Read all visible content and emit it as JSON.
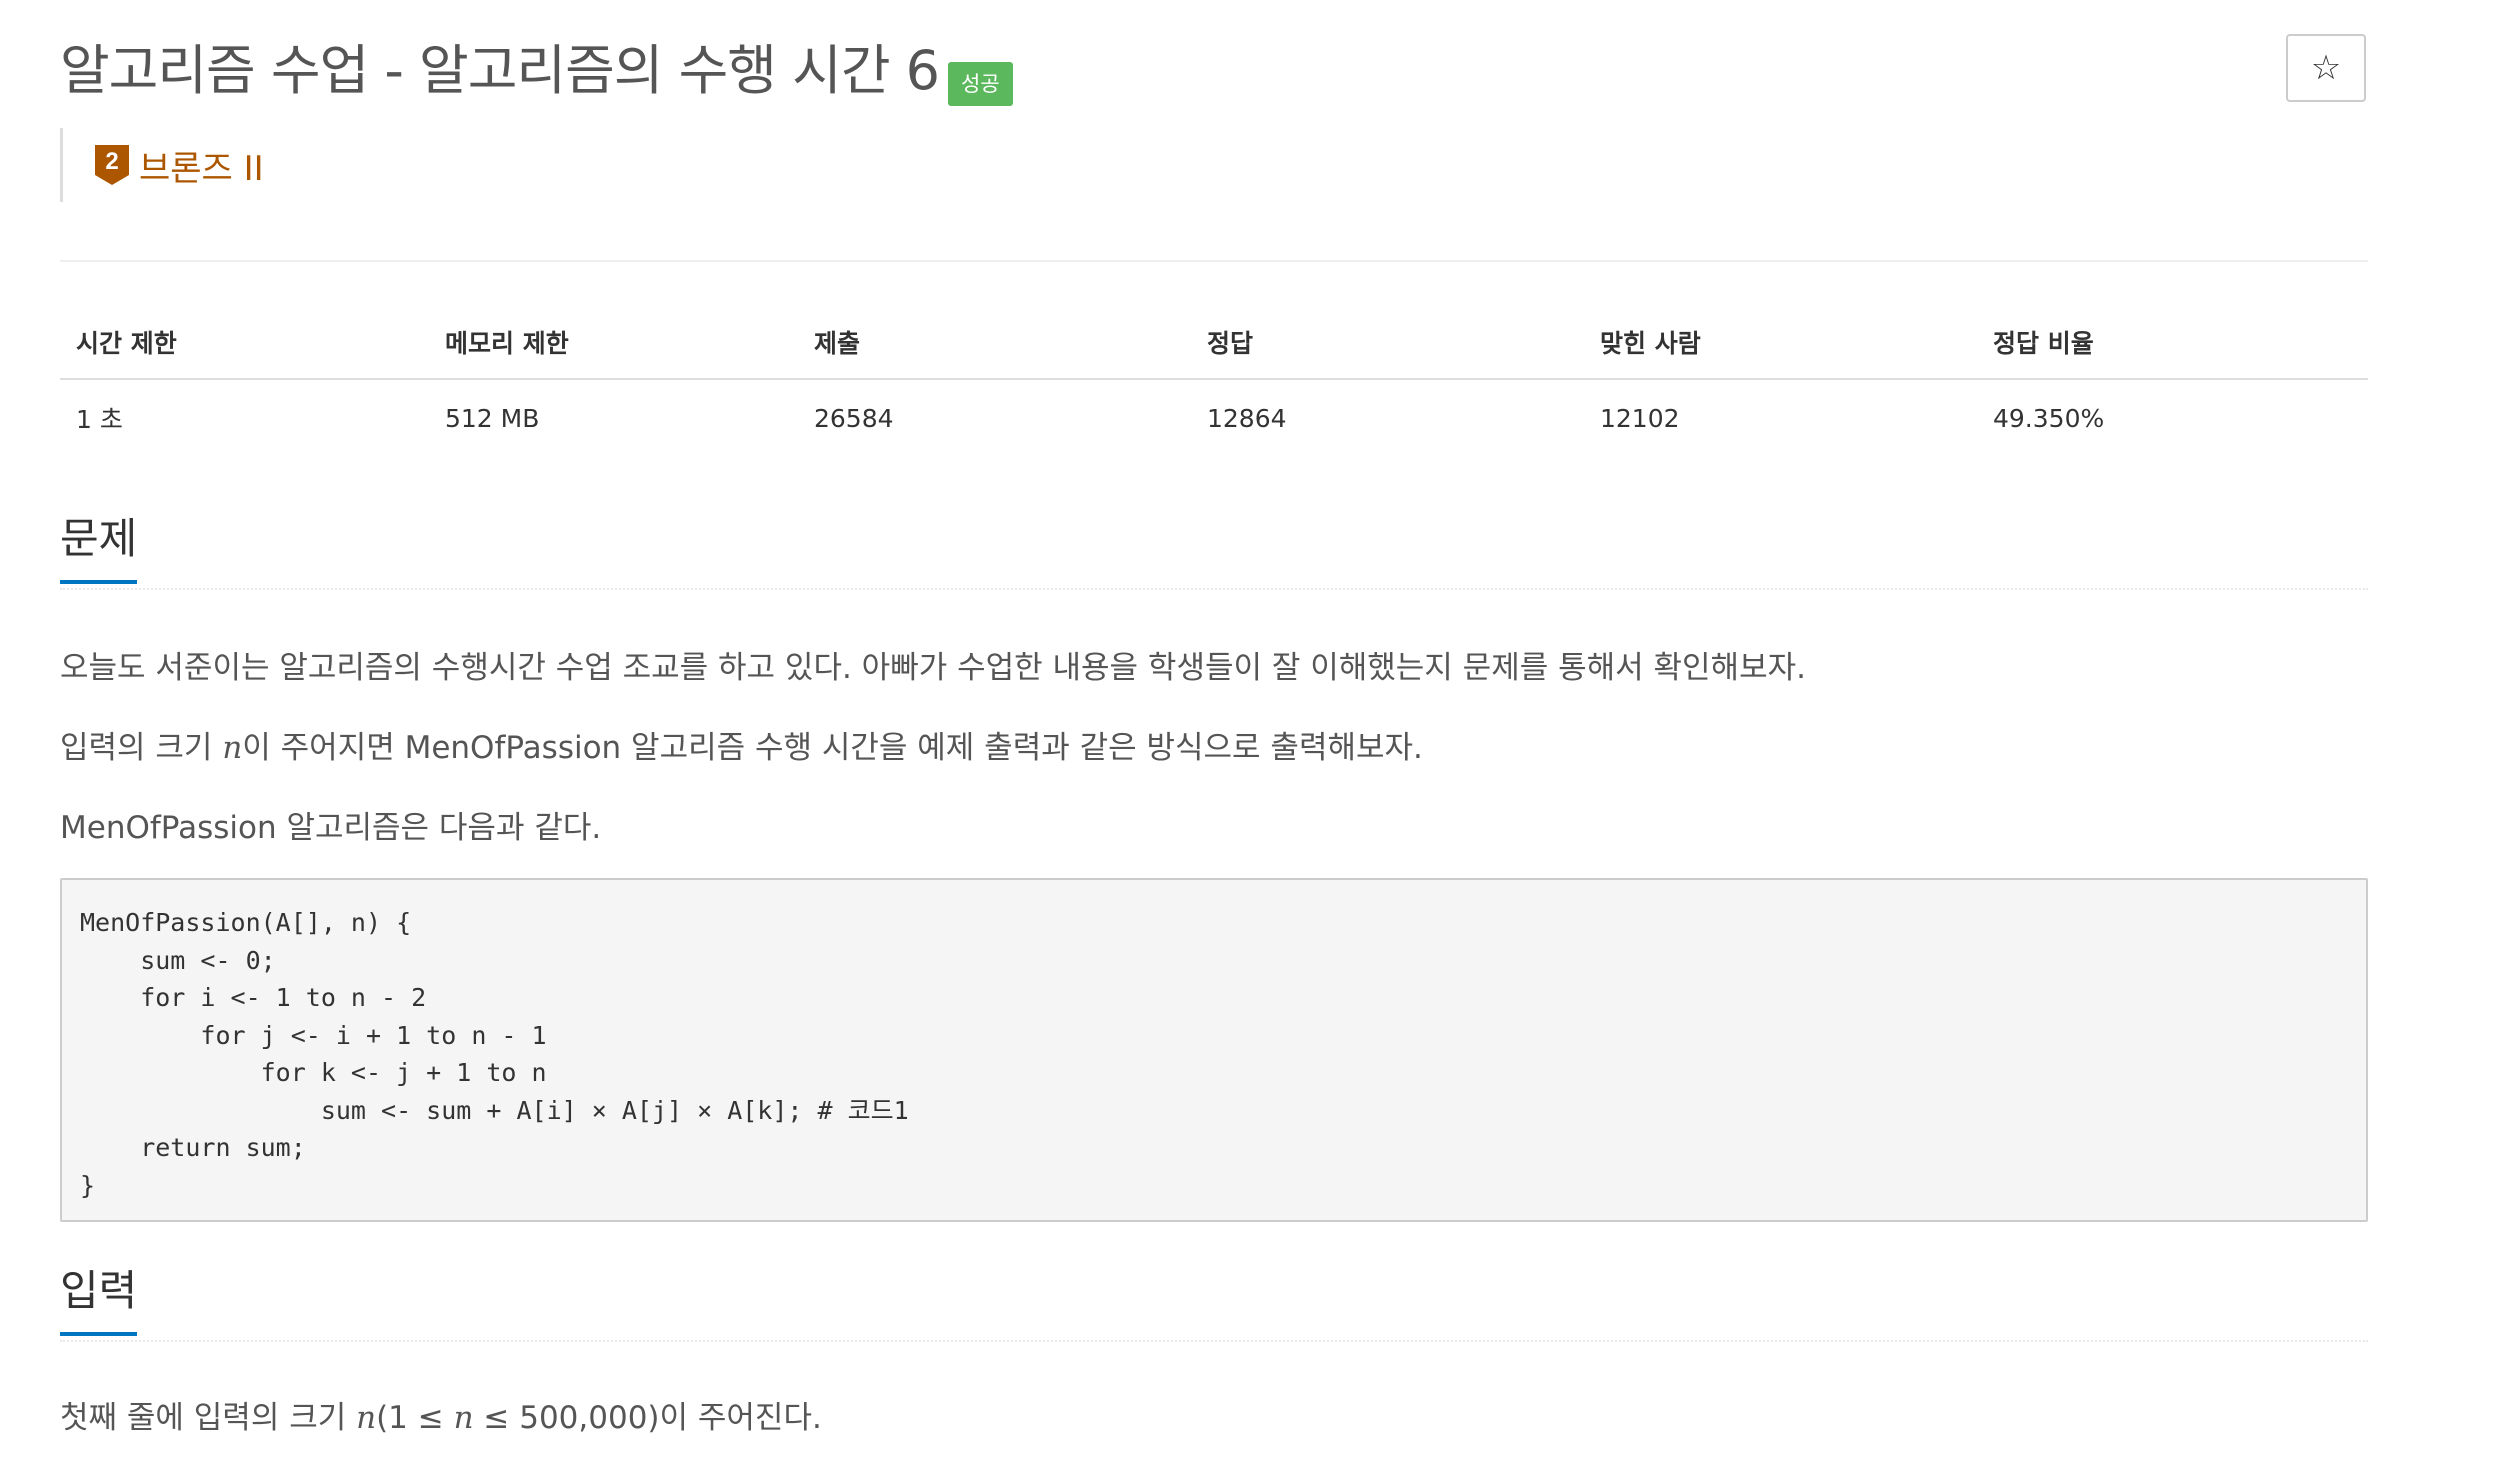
{
  "header": {
    "title": "알고리즘 수업 - 알고리즘의 수행 시간 6",
    "status_badge": "성공",
    "star_icon": "☆",
    "tier": {
      "number": "2",
      "label": "브론즈 II",
      "color": "#ad5600"
    }
  },
  "info_table": {
    "headers": [
      "시간 제한",
      "메모리 제한",
      "제출",
      "정답",
      "맞힌 사람",
      "정답 비율"
    ],
    "values": [
      "1 초",
      "512 MB",
      "26584",
      "12864",
      "12102",
      "49.350%"
    ]
  },
  "problem": {
    "heading": "문제",
    "para1": "오늘도 서준이는 알고리즘의 수행시간 수업 조교를 하고 있다. 아빠가 수업한 내용을 학생들이 잘 이해했는지 문제를 통해서 확인해보자.",
    "para2_prefix": "입력의 크기 ",
    "para2_var": "n",
    "para2_suffix": "이 주어지면 MenOfPassion 알고리즘 수행 시간을 예제 출력과 같은 방식으로 출력해보자.",
    "para3": "MenOfPassion 알고리즘은 다음과 같다.",
    "code_lines": [
      "MenOfPassion(A[], n) {",
      "    sum <- 0;",
      "    for i <- 1 to n - 2",
      "        for j <- i + 1 to n - 1",
      "            for k <- j + 1 to n",
      "                sum <- sum + A[i] × A[j] × A[k]; # 코드1",
      "    return sum;",
      "}"
    ]
  },
  "input_section": {
    "heading": "입력",
    "text_prefix": "첫째 줄에 입력의 크기 ",
    "var1": "n",
    "text_mid1": "(1 ≤ ",
    "var2": "n",
    "text_mid2": " ≤ 500,000)이 주어진다."
  },
  "colors": {
    "success_badge": "#5cb85c",
    "section_underline": "#0076c0"
  }
}
